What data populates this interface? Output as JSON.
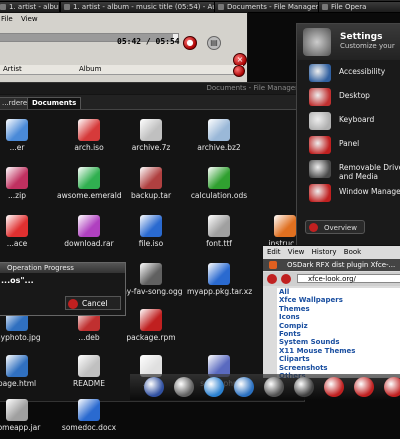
{
  "taskbar": {
    "items": [
      {
        "label": "1. artist - album - music ti..."
      },
      {
        "label": "1. artist - album - music title (05:54) - Audacious"
      },
      {
        "label": "Documents - File Manager"
      },
      {
        "label": "File Opera"
      }
    ]
  },
  "audacious": {
    "menu": [
      "File",
      "View"
    ],
    "time": "05:42 / 05:54",
    "columns": [
      "Artist",
      "Album"
    ],
    "progress": 0.97
  },
  "file_manager": {
    "title": "Documents - File Manager",
    "tabs": [
      "...rderer",
      "Documents"
    ],
    "files": [
      {
        "name": "...er",
        "color": "#4a8ad8"
      },
      {
        "name": "arch.iso",
        "color": "#d63a3a"
      },
      {
        "name": "archive.7z",
        "color": "#c0c0c0"
      },
      {
        "name": "archive.bz2",
        "color": "#9ab8d8"
      },
      {
        "name": "...zip",
        "color": "#c03060"
      },
      {
        "name": "awsome.emerald",
        "color": "#30b050"
      },
      {
        "name": "backup.tar",
        "color": "#b04040"
      },
      {
        "name": "calculation.ods",
        "color": "#30a030"
      },
      {
        "name": "...ace",
        "color": "#e03030"
      },
      {
        "name": "download.rar",
        "color": "#b040c0"
      },
      {
        "name": "file.iso",
        "color": "#2a6ad0"
      },
      {
        "name": "font.ttf",
        "color": "#a0a0a0"
      },
      {
        "name": "instruc...",
        "color": "#e07020"
      },
      {
        "name": "...avi",
        "color": "#c03030"
      },
      {
        "name": "movie.rmvb",
        "color": "#806030"
      },
      {
        "name": "my-fav-song.ogg",
        "color": "#606060"
      },
      {
        "name": "myapp.pkg.tar.xz",
        "color": "#2a6ad0"
      },
      {
        "name": "myh...h",
        "color": "#4a8ad8"
      },
      {
        "name": "myphoto.jpg",
        "color": "#3070c0"
      },
      {
        "name": "...deb",
        "color": "#c03030"
      },
      {
        "name": "package.rpm",
        "color": "#c02020"
      },
      {
        "name": "page.html",
        "color": "#3070c0"
      },
      {
        "name": "README",
        "color": "#c0c0c0"
      },
      {
        "name": "...arl",
        "color": "#e0e0e0"
      },
      {
        "name": "script.php",
        "color": "#5a6ac0"
      },
      {
        "name": "someapp.jar",
        "color": "#a0a0a0"
      },
      {
        "name": "somedoc.docx",
        "color": "#2a6ad0"
      }
    ]
  },
  "settings": {
    "title": "Settings",
    "subtitle": "Customize your",
    "items": [
      {
        "label": "Accessibility",
        "color": "#3060a0"
      },
      {
        "label": "Desktop",
        "color": "#c03030"
      },
      {
        "label": "Keyboard",
        "color": "#b0b0b0"
      },
      {
        "label": "Panel",
        "color": "#c02020"
      },
      {
        "label": "Removable Drive and Media",
        "color": "#4a4a4a"
      },
      {
        "label": "Window Manage",
        "color": "#c02020"
      }
    ],
    "overview_label": "Overview"
  },
  "operation_progress": {
    "title": "Operation Progress",
    "message": "...os\"...",
    "cancel_label": "Cancel"
  },
  "firefox": {
    "menu": [
      "Edit",
      "View",
      "History",
      "Book"
    ],
    "tab_title": "OSDark RFX dist plugin Xfce-...",
    "url": "xfce-look.org/",
    "links": [
      "All",
      "Xfce Wallpapers",
      "Themes",
      "Icons",
      "Compiz",
      "Fonts",
      "System Sounds",
      "X11 Mouse Themes",
      "Cliparts",
      "Screenshots",
      "Others"
    ]
  },
  "dock": {
    "icons": [
      {
        "name": "launcher-icon",
        "color": "#3050a0"
      },
      {
        "name": "monitor-icon",
        "color": "#606060"
      },
      {
        "name": "globe-icon",
        "color": "#2a80d0"
      },
      {
        "name": "mail-icon",
        "color": "#2a70c0"
      },
      {
        "name": "settings-icon",
        "color": "#505050"
      },
      {
        "name": "film-icon",
        "color": "#404040"
      },
      {
        "name": "media-icon",
        "color": "#c02020"
      },
      {
        "name": "logout-icon",
        "color": "#c02020"
      },
      {
        "name": "power-icon",
        "color": "#c02020"
      }
    ]
  }
}
